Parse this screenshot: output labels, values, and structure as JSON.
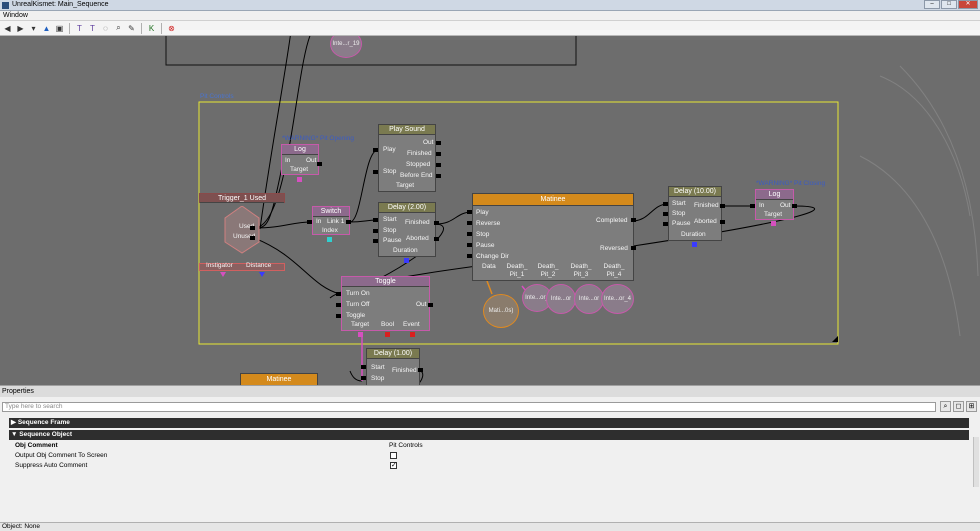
{
  "window": {
    "title": "UnrealKismet: Main_Sequence",
    "menu": "Window"
  },
  "toolbar_icons": [
    "back-icon",
    "forward-icon",
    "dropdown-icon",
    "up-icon",
    "open-icon",
    "new-icon",
    "rename-icon",
    "bulb-icon",
    "search-icon",
    "tools-icon",
    "k-icon",
    "stop-icon"
  ],
  "canvas": {
    "top_fragment": {
      "label": "Inte...r_19"
    },
    "comment_title": "Pit Controls",
    "warning_opening": "*WARNING* Pit Opening",
    "warning_closing": "*WARNING* Pit Closing",
    "log1": {
      "title": "Log",
      "in": "In",
      "out": "Out",
      "target": "Target"
    },
    "log2": {
      "title": "Log",
      "in": "In",
      "out": "Out",
      "target": "Target"
    },
    "play_sound": {
      "title": "Play Sound",
      "play": "Play",
      "stop": "Stop",
      "out": "Out",
      "finished": "Finished",
      "stopped": "Stopped",
      "before_end": "Before End",
      "target": "Target"
    },
    "trigger": {
      "title": "Trigger_1 Used",
      "used": "Used",
      "unused": "Unused",
      "instigator": "Instigator",
      "distance": "Distance"
    },
    "switch": {
      "title": "Switch",
      "in": "In",
      "link1": "Link 1",
      "index": "Index"
    },
    "delay2": {
      "title": "Delay (2.00)",
      "start": "Start",
      "stop": "Stop",
      "pause": "Pause",
      "finished": "Finished",
      "aborted": "Aborted",
      "duration": "Duration"
    },
    "matinee": {
      "title": "Matinee",
      "play": "Play",
      "reverse": "Reverse",
      "stop": "Stop",
      "pause": "Pause",
      "change_dir": "Change Dir",
      "completed": "Completed",
      "reversed": "Reversed",
      "data": "Data",
      "pit1": "Death_ Pit_1",
      "pit2": "Death_ Pit_2",
      "pit3": "Death_ Pit_3",
      "pit4": "Death_ Pit_4"
    },
    "delay10": {
      "title": "Delay (10.00)",
      "start": "Start",
      "stop": "Stop",
      "pause": "Pause",
      "finished": "Finished",
      "aborted": "Aborted",
      "duration": "Duration"
    },
    "toggle": {
      "title": "Toggle",
      "turn_on": "Turn On",
      "turn_off": "Turn Off",
      "toggle": "Toggle",
      "out": "Out",
      "target": "Target",
      "bool": "Bool",
      "event": "Event"
    },
    "delay1": {
      "title": "Delay (1.00)",
      "start": "Start",
      "stop": "Stop",
      "finished": "Finished"
    },
    "matinee_bottom": {
      "title": "Matinee"
    },
    "vars": {
      "mati": "Mati...0s)",
      "int1": "Inte...or_",
      "int2": "Inte...or",
      "int3": "Inte...or",
      "int4": "Inte...or_4"
    }
  },
  "properties": {
    "header": "Properties",
    "search_placeholder": "Type here to search",
    "sections": [
      {
        "label": "Sequence Frame"
      },
      {
        "label": "Sequence Object"
      }
    ],
    "rows": [
      {
        "key": "Obj Comment",
        "value": "Pit Controls"
      },
      {
        "key": "Output Obj Comment To Screen",
        "checked": false
      },
      {
        "key": "Suppress Auto Comment",
        "checked": true
      }
    ]
  },
  "status": "Object: None",
  "colors": {
    "canvas": "#6d6d6d",
    "comment_border": "#e6e632",
    "link_pink": "#d650c0",
    "var_blue": "#3a3aff",
    "var_cyan": "#30d0d0",
    "var_red": "#d82020"
  }
}
